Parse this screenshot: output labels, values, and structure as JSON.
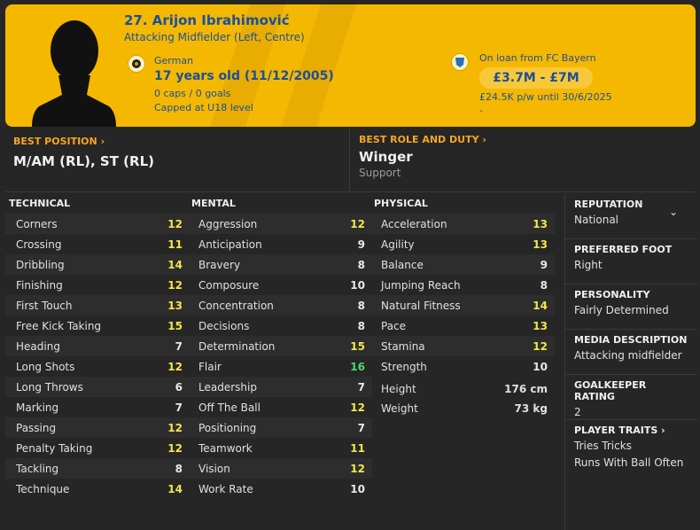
{
  "header": {
    "name": "27. Arijon Ibrahimović",
    "role": "Attacking Midfielder (Left, Centre)",
    "nationality": "German",
    "age": "17 years old (11/12/2005)",
    "caps": "0 caps / 0 goals",
    "capped_at": "Capped at U18 level",
    "loan": "On loan from FC Bayern",
    "value": "£3.7M - £7M",
    "wage": "£24.5K p/w until 30/6/2025",
    "dash": "-",
    "colors": {
      "banner": "#f5b800",
      "text": "#1a4f9c"
    }
  },
  "best_position": {
    "label": "BEST POSITION",
    "value": "M/AM (RL), ST (RL)"
  },
  "best_role": {
    "label": "BEST ROLE AND DUTY",
    "value": "Winger",
    "duty": "Support"
  },
  "technical": {
    "title": "TECHNICAL",
    "rows": [
      {
        "name": "Corners",
        "value": "12"
      },
      {
        "name": "Crossing",
        "value": "11"
      },
      {
        "name": "Dribbling",
        "value": "14"
      },
      {
        "name": "Finishing",
        "value": "12"
      },
      {
        "name": "First Touch",
        "value": "13"
      },
      {
        "name": "Free Kick Taking",
        "value": "15"
      },
      {
        "name": "Heading",
        "value": "7"
      },
      {
        "name": "Long Shots",
        "value": "12"
      },
      {
        "name": "Long Throws",
        "value": "6"
      },
      {
        "name": "Marking",
        "value": "7"
      },
      {
        "name": "Passing",
        "value": "12"
      },
      {
        "name": "Penalty Taking",
        "value": "12"
      },
      {
        "name": "Tackling",
        "value": "8"
      },
      {
        "name": "Technique",
        "value": "14"
      }
    ]
  },
  "mental": {
    "title": "MENTAL",
    "rows": [
      {
        "name": "Aggression",
        "value": "12"
      },
      {
        "name": "Anticipation",
        "value": "9"
      },
      {
        "name": "Bravery",
        "value": "8"
      },
      {
        "name": "Composure",
        "value": "10"
      },
      {
        "name": "Concentration",
        "value": "8"
      },
      {
        "name": "Decisions",
        "value": "8"
      },
      {
        "name": "Determination",
        "value": "15"
      },
      {
        "name": "Flair",
        "value": "16"
      },
      {
        "name": "Leadership",
        "value": "7"
      },
      {
        "name": "Off The Ball",
        "value": "12"
      },
      {
        "name": "Positioning",
        "value": "7"
      },
      {
        "name": "Teamwork",
        "value": "11"
      },
      {
        "name": "Vision",
        "value": "12"
      },
      {
        "name": "Work Rate",
        "value": "10"
      }
    ]
  },
  "physical": {
    "title": "PHYSICAL",
    "rows": [
      {
        "name": "Acceleration",
        "value": "13"
      },
      {
        "name": "Agility",
        "value": "13"
      },
      {
        "name": "Balance",
        "value": "9"
      },
      {
        "name": "Jumping Reach",
        "value": "8"
      },
      {
        "name": "Natural Fitness",
        "value": "14"
      },
      {
        "name": "Pace",
        "value": "13"
      },
      {
        "name": "Stamina",
        "value": "12"
      },
      {
        "name": "Strength",
        "value": "10"
      }
    ],
    "height_label": "Height",
    "height": "176 cm",
    "weight_label": "Weight",
    "weight": "73 kg"
  },
  "side": {
    "reputation_label": "REPUTATION",
    "reputation": "National",
    "foot_label": "PREFERRED FOOT",
    "foot": "Right",
    "personality_label": "PERSONALITY",
    "personality": "Fairly Determined",
    "media_label": "MEDIA DESCRIPTION",
    "media": "Attacking midfielder",
    "gk_label": "GOALKEEPER RATING",
    "gk": "2",
    "traits_label": "PLAYER TRAITS",
    "traits": [
      "Tries Tricks",
      "Runs With Ball Often"
    ]
  }
}
